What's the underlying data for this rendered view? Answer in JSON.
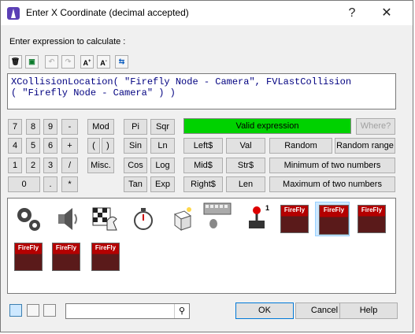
{
  "window": {
    "title": "Enter X Coordinate (decimal accepted)"
  },
  "titlebar": {
    "help": "?",
    "close": "✕"
  },
  "prompt": "Enter expression to calculate :",
  "toolbar": [
    {
      "name": "delete-icon",
      "glyph": "🗑"
    },
    {
      "name": "insert-icon",
      "glyph": "▣"
    },
    {
      "name": "undo-icon",
      "glyph": "↶"
    },
    {
      "name": "redo-icon",
      "glyph": "↷"
    },
    {
      "name": "font-increase-icon",
      "glyph": "A+"
    },
    {
      "name": "font-decrease-icon",
      "glyph": "A-"
    },
    {
      "name": "swap-icon",
      "glyph": "⇆"
    }
  ],
  "expression": "XCollisionLocation( \"Firefly Node - Camera\", FVLastCollision\n( \"Firefly Node - Camera\" ) )",
  "keypad": {
    "row1": [
      "7",
      "8",
      "9",
      "-"
    ],
    "row2": [
      "4",
      "5",
      "6",
      "+"
    ],
    "row3": [
      "1",
      "2",
      "3",
      "/"
    ],
    "row4": [
      "0",
      ".",
      "*"
    ]
  },
  "functions": {
    "mod": "Mod",
    "paren_open": "(",
    "paren_close": ")",
    "misc": "Misc.",
    "pi": "Pi",
    "sqr": "Sqr",
    "sin": "Sin",
    "ln": "Ln",
    "cos": "Cos",
    "log": "Log",
    "tan": "Tan",
    "exp": "Exp"
  },
  "status": "Valid expression",
  "where": "Where?",
  "strings": {
    "left": "Left$",
    "val": "Val",
    "random": "Random",
    "random_range": "Random range",
    "mid": "Mid$",
    "str": "Str$",
    "min": "Minimum of two numbers",
    "right": "Right$",
    "len": "Len",
    "max": "Maximum of two numbers"
  },
  "icon_labels": {
    "firefly": "FireFly"
  },
  "buttons": {
    "ok": "OK",
    "cancel": "Cancel",
    "help": "Help"
  },
  "search": {
    "value": ""
  }
}
